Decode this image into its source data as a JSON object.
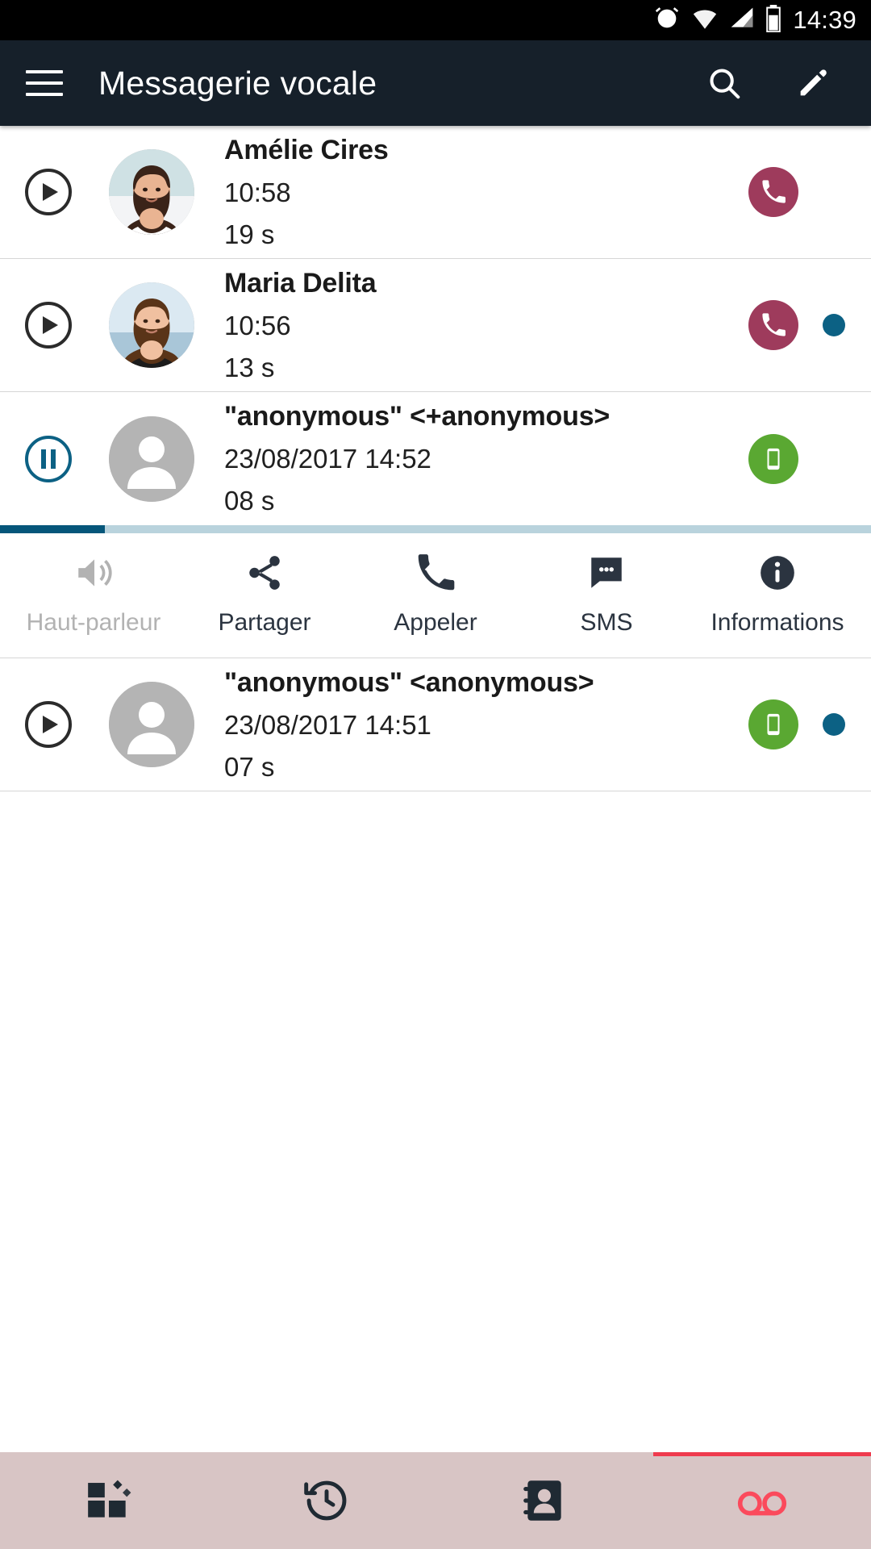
{
  "status_bar": {
    "time": "14:39",
    "icons": [
      "alarm-icon",
      "wifi-icon",
      "signal-icon",
      "battery-icon"
    ]
  },
  "app_bar": {
    "title": "Messagerie vocale",
    "menu_icon": "hamburger-menu-icon",
    "search_icon": "search-icon",
    "compose_icon": "pencil-edit-icon"
  },
  "voicemails": [
    {
      "name": "Amélie Cires",
      "date": "10:58",
      "duration": "19 s",
      "play_state": "play",
      "badge": "call",
      "unread": false,
      "avatar": "photo-woman-1"
    },
    {
      "name": "Maria Delita",
      "date": "10:56",
      "duration": "13 s",
      "play_state": "play",
      "badge": "call",
      "unread": true,
      "avatar": "photo-woman-2"
    },
    {
      "name": "\"anonymous\" <+anonymous>",
      "date": "23/08/2017 14:52",
      "duration": "08 s",
      "play_state": "pause",
      "badge": "mobile",
      "unread": false,
      "avatar": "placeholder-person"
    },
    {
      "name": "\"anonymous\" <anonymous>",
      "date": "23/08/2017 14:51",
      "duration": "07 s",
      "play_state": "play",
      "badge": "mobile",
      "unread": true,
      "avatar": "placeholder-person"
    }
  ],
  "player": {
    "progress_percent": 12,
    "actions": [
      {
        "label": "Haut-parleur",
        "icon": "speaker-icon",
        "disabled": true
      },
      {
        "label": "Partager",
        "icon": "share-icon",
        "disabled": false
      },
      {
        "label": "Appeler",
        "icon": "phone-icon",
        "disabled": false
      },
      {
        "label": "SMS",
        "icon": "sms-bubble-icon",
        "disabled": false
      },
      {
        "label": "Informations",
        "icon": "info-icon",
        "disabled": false
      }
    ]
  },
  "bottom_nav": [
    {
      "name": "apps-grid-icon",
      "active": false
    },
    {
      "name": "call-history-icon",
      "active": false
    },
    {
      "name": "contacts-icon",
      "active": false
    },
    {
      "name": "voicemail-icon",
      "active": true
    }
  ],
  "colors": {
    "appbar_bg": "#16202a",
    "badge_call": "#9e3b5c",
    "badge_mobile": "#5aa832",
    "unread_dot": "#0c6184",
    "progress_fill": "#06567a",
    "progress_track": "#b9d3dd",
    "bottom_nav_bg": "#d8c5c5",
    "active_tab": "#ef3b4e"
  }
}
